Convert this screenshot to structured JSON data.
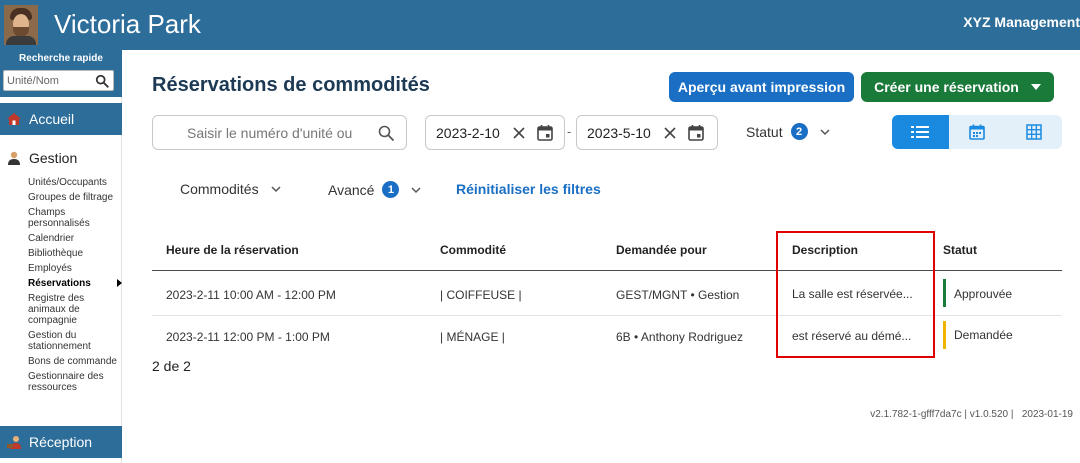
{
  "header": {
    "site_title": "Victoria Park",
    "org_name": "XYZ Management"
  },
  "sidebar": {
    "quick_search_label": "Recherche rapide",
    "quick_search_placeholder": "Unité/Nom",
    "accueil": "Accueil",
    "gestion": "Gestion",
    "reception": "Réception",
    "items": [
      {
        "label": "Unités/Occupants"
      },
      {
        "label": "Groupes de filtrage"
      },
      {
        "label": "Champs personnalisés"
      },
      {
        "label": "Calendrier"
      },
      {
        "label": "Bibliothèque"
      },
      {
        "label": "Employés"
      },
      {
        "label": "Réservations"
      },
      {
        "label": "Registre des animaux de compagnie"
      },
      {
        "label": "Gestion du stationnement"
      },
      {
        "label": "Bons de commande"
      },
      {
        "label": "Gestionnaire des ressources"
      }
    ],
    "active_item": "Réservations"
  },
  "main": {
    "page_title": "Réservations de commodités",
    "print_button": "Aperçu avant impression",
    "create_button": "Créer une réservation",
    "search_placeholder": "Saisir le numéro d'unité ou",
    "date_start": "2023-2-10",
    "date_end": "2023-5-10",
    "date_separator": "-",
    "status_filter_label": "Statut",
    "status_filter_count": "2",
    "filter_commodites": "Commodités",
    "filter_avance": "Avancé",
    "filter_avance_count": "1",
    "reset_filters": "Réinitialiser les filtres",
    "count_text": "2 de 2"
  },
  "table": {
    "columns": [
      "Heure de la réservation",
      "Commodité",
      "Demandée pour",
      "Description",
      "Statut"
    ],
    "rows": [
      {
        "time": "2023-2-11 10:00 AM - 12:00 PM",
        "amenity": "| COIFFEUSE |",
        "requested_for": "GEST/MGNT • Gestion",
        "description": "La salle est réservée...",
        "status": "Approuvée",
        "status_color": "#1a7a3a"
      },
      {
        "time": "2023-2-11 12:00 PM - 1:00 PM",
        "amenity": "| MÉNAGE |",
        "requested_for": "6B • Anthony Rodriguez",
        "description": "est réservé au démé...",
        "status": "Demandée",
        "status_color": "#f0b400"
      }
    ]
  },
  "footer": {
    "version": "v2.1.782-1-gfff7da7c | v1.0.520 |",
    "date": "2023-01-19"
  },
  "colors": {
    "header_blue": "#2c6d99",
    "primary_blue": "#1a6fc4",
    "create_green": "#1a7a3a",
    "highlight_red": "#e00000"
  }
}
